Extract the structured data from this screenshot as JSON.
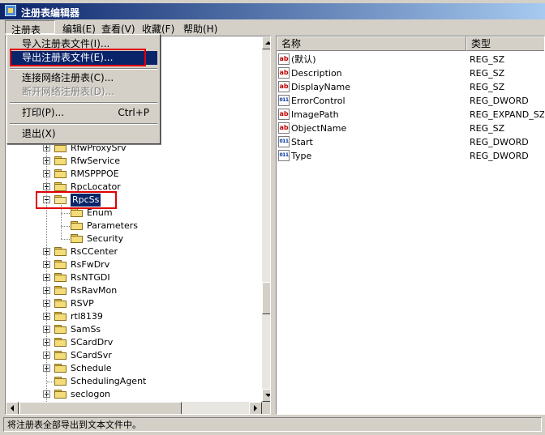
{
  "window": {
    "title": "注册表编辑器"
  },
  "menubar": {
    "registry": "注册表(R)",
    "edit": "编辑(E)",
    "view": "查看(V)",
    "favorites": "收藏(F)",
    "help": "帮助(H)"
  },
  "registry_menu": {
    "import": "导入注册表文件(I)...",
    "export": "导出注册表文件(E)...",
    "connect": "连接网络注册表(C)...",
    "disconnect": "断开网络注册表(D)...",
    "print": "打印(P)...",
    "print_shortcut": "Ctrl+P",
    "exit": "退出(X)"
  },
  "tree": {
    "items": [
      {
        "label": "RfwProxySrv"
      },
      {
        "label": "RfwService"
      },
      {
        "label": "RMSPPPOE"
      },
      {
        "label": "RpcLocator"
      },
      {
        "label": "RpcSs",
        "selected": true,
        "expanded": true
      },
      {
        "label": "Enum"
      },
      {
        "label": "Parameters"
      },
      {
        "label": "Security"
      },
      {
        "label": "RsCCenter"
      },
      {
        "label": "RsFwDrv"
      },
      {
        "label": "RsNTGDI"
      },
      {
        "label": "RsRavMon"
      },
      {
        "label": "RSVP"
      },
      {
        "label": "rtl8139"
      },
      {
        "label": "SamSs"
      },
      {
        "label": "SCardDrv"
      },
      {
        "label": "SCardSvr"
      },
      {
        "label": "Schedule"
      },
      {
        "label": "SchedulingAgent"
      },
      {
        "label": "seclogon"
      }
    ]
  },
  "list": {
    "col_name": "名称",
    "col_type": "类型",
    "rows": [
      {
        "name": "(默认)",
        "type": "REG_SZ",
        "icon": "string-value-icon"
      },
      {
        "name": "Description",
        "type": "REG_SZ",
        "icon": "string-value-icon"
      },
      {
        "name": "DisplayName",
        "type": "REG_SZ",
        "icon": "string-value-icon"
      },
      {
        "name": "ErrorControl",
        "type": "REG_DWORD",
        "icon": "binary-value-icon"
      },
      {
        "name": "ImagePath",
        "type": "REG_EXPAND_SZ",
        "icon": "string-value-icon"
      },
      {
        "name": "ObjectName",
        "type": "REG_SZ",
        "icon": "string-value-icon"
      },
      {
        "name": "Start",
        "type": "REG_DWORD",
        "icon": "binary-value-icon"
      },
      {
        "name": "Type",
        "type": "REG_DWORD",
        "icon": "binary-value-icon"
      }
    ]
  },
  "icons": {
    "string": "ab",
    "binary": "011"
  },
  "statusbar": {
    "text": "将注册表全部导出到文本文件中。"
  },
  "colors": {
    "highlight": "#0a246a",
    "annotation_box": "#e00000",
    "folder": "#f4dc78"
  }
}
